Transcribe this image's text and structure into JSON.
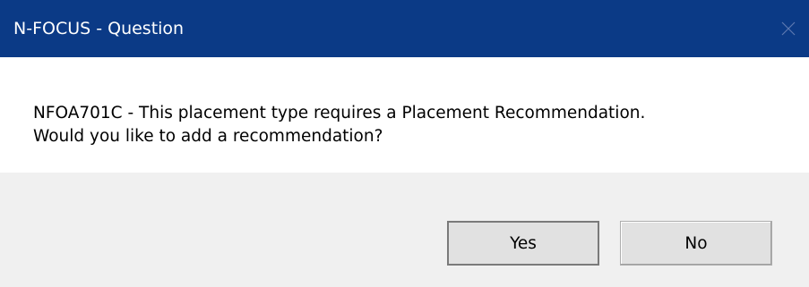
{
  "window": {
    "title": "N-FOCUS - Question",
    "colors": {
      "titlebar": "#0b3a86",
      "footer": "#f0f0f0",
      "button": "#e1e1e1"
    }
  },
  "message": {
    "line1": "NFOA701C - This placement type requires a Placement Recommendation.",
    "line2": "Would you like to add a recommendation?"
  },
  "buttons": {
    "yes_label": "Yes",
    "no_label": "No"
  },
  "icons": {
    "close": "close-icon"
  }
}
